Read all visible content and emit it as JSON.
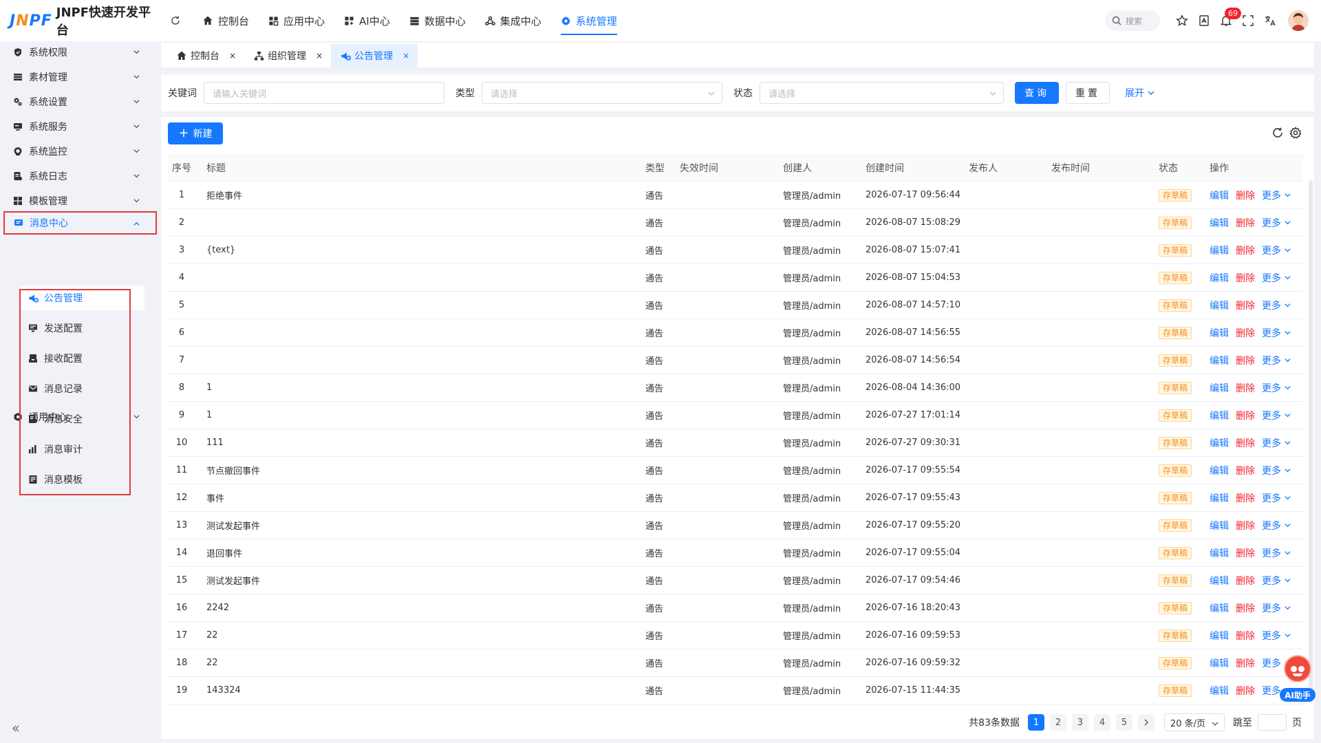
{
  "app": {
    "logo_mark": "JNPF",
    "title": "JNPF快速开发平台"
  },
  "topnav": [
    {
      "label": "控制台",
      "icon": "home-icon"
    },
    {
      "label": "应用中心",
      "icon": "apps-icon"
    },
    {
      "label": "AI中心",
      "icon": "ai-icon"
    },
    {
      "label": "数据中心",
      "icon": "database-icon"
    },
    {
      "label": "集成中心",
      "icon": "integration-icon"
    },
    {
      "label": "系统管理",
      "icon": "gear-icon",
      "active": true
    }
  ],
  "topbar": {
    "search_placeholder": "搜索",
    "notice_count": "69"
  },
  "sidebar": {
    "items": [
      {
        "label": "系统权限",
        "icon": "shield-icon"
      },
      {
        "label": "素材管理",
        "icon": "folder-icon"
      },
      {
        "label": "系统设置",
        "icon": "settings-icon"
      },
      {
        "label": "系统服务",
        "icon": "server-icon"
      },
      {
        "label": "系统监控",
        "icon": "monitor-icon"
      },
      {
        "label": "系统日志",
        "icon": "log-icon"
      },
      {
        "label": "模板管理",
        "icon": "template-icon"
      },
      {
        "label": "消息中心",
        "icon": "message-icon",
        "open": true
      },
      {
        "label": "通用中心",
        "icon": "common-icon"
      }
    ],
    "subitems": [
      {
        "label": "公告管理",
        "icon": "announcement-icon",
        "active": true
      },
      {
        "label": "发送配置",
        "icon": "send-icon"
      },
      {
        "label": "接收配置",
        "icon": "inbox-icon"
      },
      {
        "label": "消息记录",
        "icon": "mail-icon"
      },
      {
        "label": "消息安全",
        "icon": "security-icon"
      },
      {
        "label": "消息审计",
        "icon": "chart-icon"
      },
      {
        "label": "消息模板",
        "icon": "doc-icon"
      }
    ]
  },
  "tabs": [
    {
      "label": "控制台",
      "icon": "home-icon"
    },
    {
      "label": "组织管理",
      "icon": "org-icon"
    },
    {
      "label": "公告管理",
      "icon": "announcement-icon",
      "active": true
    }
  ],
  "search": {
    "keyword_label": "关键词",
    "keyword_placeholder": "请输入关键词",
    "type_label": "类型",
    "type_placeholder": "请选择",
    "status_label": "状态",
    "status_placeholder": "请选择",
    "query_label": "查询",
    "reset_label": "重置",
    "expand_label": "展开"
  },
  "toolbar": {
    "new_label": "新建"
  },
  "table": {
    "headers": {
      "idx": "序号",
      "title": "标题",
      "type": "类型",
      "expire": "失效时间",
      "creator": "创建人",
      "ctime": "创建时间",
      "publisher": "发布人",
      "ptime": "发布时间",
      "status": "状态",
      "ops": "操作"
    },
    "ops": {
      "edit": "编辑",
      "delete": "删除",
      "more": "更多"
    },
    "rows": [
      {
        "idx": "1",
        "title": "拒绝事件",
        "type": "通告",
        "creator": "管理员/admin",
        "ctime": "2026-07-17 09:56:44",
        "status": "存草稿"
      },
      {
        "idx": "2",
        "title": "",
        "type": "通告",
        "creator": "管理员/admin",
        "ctime": "2026-08-07 15:08:29",
        "status": "存草稿"
      },
      {
        "idx": "3",
        "title": "{text}",
        "type": "通告",
        "creator": "管理员/admin",
        "ctime": "2026-08-07 15:07:41",
        "status": "存草稿"
      },
      {
        "idx": "4",
        "title": "",
        "type": "通告",
        "creator": "管理员/admin",
        "ctime": "2026-08-07 15:04:53",
        "status": "存草稿"
      },
      {
        "idx": "5",
        "title": "",
        "type": "通告",
        "creator": "管理员/admin",
        "ctime": "2026-08-07 14:57:10",
        "status": "存草稿"
      },
      {
        "idx": "6",
        "title": "",
        "type": "通告",
        "creator": "管理员/admin",
        "ctime": "2026-08-07 14:56:55",
        "status": "存草稿"
      },
      {
        "idx": "7",
        "title": "",
        "type": "通告",
        "creator": "管理员/admin",
        "ctime": "2026-08-07 14:56:54",
        "status": "存草稿"
      },
      {
        "idx": "8",
        "title": "1",
        "type": "通告",
        "creator": "管理员/admin",
        "ctime": "2026-08-04 14:36:00",
        "status": "存草稿"
      },
      {
        "idx": "9",
        "title": "1",
        "type": "通告",
        "creator": "管理员/admin",
        "ctime": "2026-07-27 17:01:14",
        "status": "存草稿"
      },
      {
        "idx": "10",
        "title": "111",
        "type": "通告",
        "creator": "管理员/admin",
        "ctime": "2026-07-27 09:30:31",
        "status": "存草稿"
      },
      {
        "idx": "11",
        "title": "节点撤回事件",
        "type": "通告",
        "creator": "管理员/admin",
        "ctime": "2026-07-17 09:55:54",
        "status": "存草稿"
      },
      {
        "idx": "12",
        "title": "事件",
        "type": "通告",
        "creator": "管理员/admin",
        "ctime": "2026-07-17 09:55:43",
        "status": "存草稿"
      },
      {
        "idx": "13",
        "title": "测试发起事件",
        "type": "通告",
        "creator": "管理员/admin",
        "ctime": "2026-07-17 09:55:20",
        "status": "存草稿"
      },
      {
        "idx": "14",
        "title": "退回事件",
        "type": "通告",
        "creator": "管理员/admin",
        "ctime": "2026-07-17 09:55:04",
        "status": "存草稿"
      },
      {
        "idx": "15",
        "title": "测试发起事件",
        "type": "通告",
        "creator": "管理员/admin",
        "ctime": "2026-07-17 09:54:46",
        "status": "存草稿"
      },
      {
        "idx": "16",
        "title": "2242",
        "type": "通告",
        "creator": "管理员/admin",
        "ctime": "2026-07-16 18:20:43",
        "status": "存草稿"
      },
      {
        "idx": "17",
        "title": "22",
        "type": "通告",
        "creator": "管理员/admin",
        "ctime": "2026-07-16 09:59:53",
        "status": "存草稿"
      },
      {
        "idx": "18",
        "title": "22",
        "type": "通告",
        "creator": "管理员/admin",
        "ctime": "2026-07-16 09:59:32",
        "status": "存草稿"
      },
      {
        "idx": "19",
        "title": "143324",
        "type": "通告",
        "creator": "管理员/admin",
        "ctime": "2026-07-15 11:44:35",
        "status": "存草稿"
      }
    ]
  },
  "pagination": {
    "total": "共83条数据",
    "pages": [
      "1",
      "2",
      "3",
      "4",
      "5"
    ],
    "current": "1",
    "page_size": "20 条/页",
    "jump_label": "跳至",
    "page_suffix": "页"
  },
  "ai": {
    "label": "AI助手"
  },
  "colors": {
    "primary": "#1677ff",
    "danger": "#f5222d",
    "warning": "#fa8c16",
    "highlight_box": "#e23b3b"
  }
}
